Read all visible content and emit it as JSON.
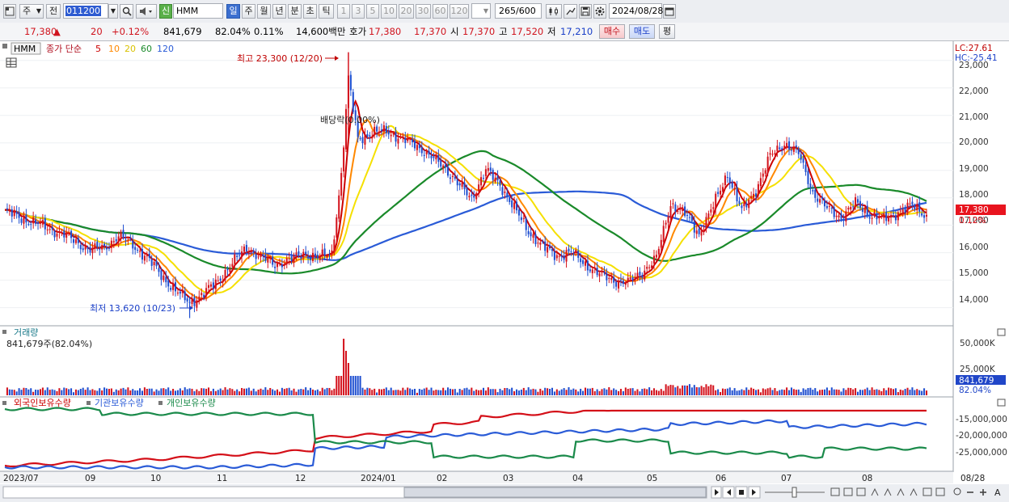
{
  "toolbar": {
    "market_label": "주",
    "prev_label": "전",
    "code_value": "011200",
    "name_badge": "신",
    "stock_name": "HMM",
    "period_buttons": [
      "일",
      "주",
      "월",
      "년",
      "분",
      "초",
      "틱"
    ],
    "interval_buttons": [
      "1",
      "3",
      "5",
      "10",
      "20",
      "30",
      "60",
      "120"
    ],
    "count_value": "265",
    "count_total": "/600",
    "date_value": "2024/08/28"
  },
  "quote": {
    "price": "17,380",
    "change_arrow": "▲",
    "change": "20",
    "change_pct": "+0.12%",
    "volume": "841,679",
    "volume_ratio": "82.04%",
    "turnover": "0.11%",
    "amount": "14,600백만",
    "bidask_label": "호가",
    "ask": "17,380",
    "bid": "17,370",
    "open_label": "시",
    "open": "17,370",
    "high_label": "고",
    "high": "17,520",
    "low_label": "저",
    "low": "17,210",
    "buy_label": "매수",
    "sell_label": "매도",
    "eval_label": "평"
  },
  "price_panel": {
    "legend_name": "HMM",
    "legend_type": "종가 단순",
    "ma_periods": [
      "5",
      "10",
      "20",
      "60",
      "120"
    ],
    "ma_colors": [
      "#cc0000",
      "#ff8800",
      "#f5e000",
      "#1a8a2a",
      "#2a5bd7"
    ],
    "lc_label": "LC:27.61",
    "hc_label": "HC:-25.41",
    "price_tag": "17,380",
    "pct_tag": "0.12%",
    "max_annotation": "최고 23,300 (12/20)",
    "min_annotation": "최저 13,620 (10/23)",
    "dividend_annotation": "배당락(0.00%)",
    "y_axis": [
      "23,000",
      "22,000",
      "21,000",
      "20,000",
      "19,000",
      "18,000",
      "17,000",
      "16,000",
      "15,000",
      "14,000"
    ]
  },
  "volume_panel": {
    "title": "거래량",
    "value_label": "841,679주(82.04%)",
    "y_axis": [
      "50,000K",
      "25,000K"
    ],
    "last_value_tag": "841,679",
    "pct_tag": "82.04%"
  },
  "holding_panel": {
    "legend": [
      "외국인보유수량",
      "기관보유수량",
      "개인보유수량"
    ],
    "legend_colors": [
      "#cc0000",
      "#2a5bd7",
      "#1a8a4a"
    ],
    "y_axis": [
      "-15,000,000",
      "-20,000,000",
      "-25,000,000"
    ]
  },
  "x_axis": [
    "2023/07",
    "09",
    "10",
    "11",
    "12",
    "2024/01",
    "02",
    "03",
    "04",
    "05",
    "06",
    "07",
    "08",
    "08/28"
  ],
  "chart_data": {
    "type": "candlestick",
    "symbol": "HMM",
    "x_labels": [
      "2023/07",
      "09",
      "10",
      "11",
      "12",
      "2024/01",
      "02",
      "03",
      "04",
      "05",
      "06",
      "07",
      "08"
    ],
    "summary": {
      "close": 17380,
      "change": 20,
      "change_pct": 0.12,
      "open": 17370,
      "high": 17520,
      "low": 17210,
      "volume": 841679,
      "volume_ratio_pct": 82.04
    },
    "period_extremes": {
      "high": {
        "value": 23300,
        "date": "12/20"
      },
      "low": {
        "value": 13620,
        "date": "10/23"
      }
    },
    "price_axis": {
      "ylim": [
        13500,
        23500
      ],
      "ticks": [
        14000,
        15000,
        16000,
        17000,
        18000,
        19000,
        20000,
        21000,
        22000,
        23000
      ]
    },
    "close_trend": [
      {
        "x": 0,
        "y": 17500
      },
      {
        "x": 6,
        "y": 17300
      },
      {
        "x": 12,
        "y": 17100
      },
      {
        "x": 18,
        "y": 16900
      },
      {
        "x": 24,
        "y": 16700
      },
      {
        "x": 30,
        "y": 16400
      },
      {
        "x": 36,
        "y": 16100
      },
      {
        "x": 42,
        "y": 16200
      },
      {
        "x": 48,
        "y": 16600
      },
      {
        "x": 54,
        "y": 16300
      },
      {
        "x": 60,
        "y": 15800
      },
      {
        "x": 66,
        "y": 15200
      },
      {
        "x": 72,
        "y": 14600
      },
      {
        "x": 78,
        "y": 14200
      },
      {
        "x": 84,
        "y": 14500
      },
      {
        "x": 90,
        "y": 15000
      },
      {
        "x": 96,
        "y": 15600
      },
      {
        "x": 102,
        "y": 16200
      },
      {
        "x": 108,
        "y": 15800
      },
      {
        "x": 114,
        "y": 15600
      },
      {
        "x": 120,
        "y": 15700
      },
      {
        "x": 126,
        "y": 16000
      },
      {
        "x": 132,
        "y": 15800
      },
      {
        "x": 138,
        "y": 16000
      },
      {
        "x": 142,
        "y": 18800
      },
      {
        "x": 145,
        "y": 22300
      },
      {
        "x": 149,
        "y": 20200
      },
      {
        "x": 155,
        "y": 20300
      },
      {
        "x": 161,
        "y": 20500
      },
      {
        "x": 167,
        "y": 20100
      },
      {
        "x": 173,
        "y": 20000
      },
      {
        "x": 179,
        "y": 19500
      },
      {
        "x": 185,
        "y": 19200
      },
      {
        "x": 191,
        "y": 18500
      },
      {
        "x": 197,
        "y": 18000
      },
      {
        "x": 203,
        "y": 19000
      },
      {
        "x": 209,
        "y": 18500
      },
      {
        "x": 215,
        "y": 17600
      },
      {
        "x": 221,
        "y": 16800
      },
      {
        "x": 227,
        "y": 16200
      },
      {
        "x": 233,
        "y": 15900
      },
      {
        "x": 239,
        "y": 16000
      },
      {
        "x": 245,
        "y": 15600
      },
      {
        "x": 251,
        "y": 15200
      },
      {
        "x": 257,
        "y": 15000
      },
      {
        "x": 263,
        "y": 14900
      },
      {
        "x": 269,
        "y": 15300
      },
      {
        "x": 275,
        "y": 15800
      },
      {
        "x": 281,
        "y": 17800
      },
      {
        "x": 287,
        "y": 17400
      },
      {
        "x": 293,
        "y": 16700
      },
      {
        "x": 299,
        "y": 17700
      },
      {
        "x": 305,
        "y": 18900
      },
      {
        "x": 311,
        "y": 17500
      },
      {
        "x": 317,
        "y": 18300
      },
      {
        "x": 323,
        "y": 19500
      },
      {
        "x": 329,
        "y": 20000
      },
      {
        "x": 335,
        "y": 19600
      },
      {
        "x": 341,
        "y": 18200
      },
      {
        "x": 347,
        "y": 17600
      },
      {
        "x": 353,
        "y": 17300
      },
      {
        "x": 359,
        "y": 17800
      },
      {
        "x": 365,
        "y": 17400
      },
      {
        "x": 371,
        "y": 17200
      },
      {
        "x": 377,
        "y": 17500
      },
      {
        "x": 383,
        "y": 17700
      },
      {
        "x": 389,
        "y": 17380
      }
    ],
    "series": [
      {
        "name": "5",
        "color": "#cc0000"
      },
      {
        "name": "10",
        "color": "#ff8800"
      },
      {
        "name": "20",
        "color": "#f5e000"
      },
      {
        "name": "60",
        "color": "#1a8a2a"
      },
      {
        "name": "120",
        "color": "#2a5bd7"
      }
    ]
  }
}
